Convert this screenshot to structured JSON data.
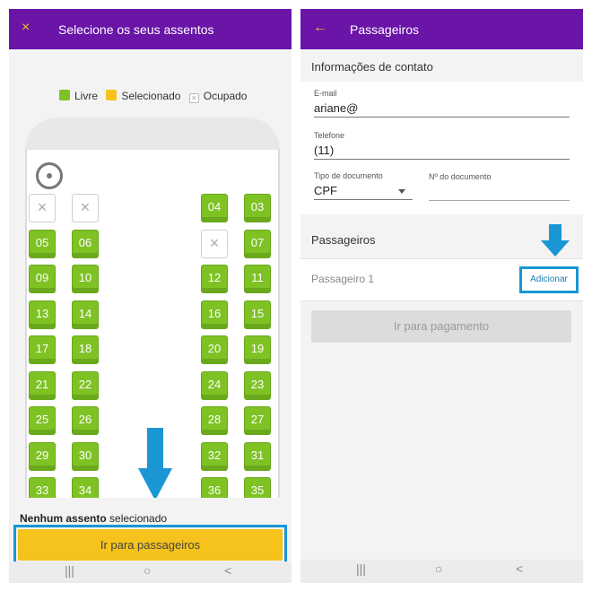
{
  "left": {
    "title": "Selecione os seus assentos",
    "close_icon": "×",
    "legend": {
      "free": "Livre",
      "selected": "Selecionado",
      "occupied": "Ocupado"
    },
    "colors": {
      "free": "#7ec224",
      "selected": "#f6c21c",
      "accent": "#6a14a8",
      "highlight": "#1a96d4"
    },
    "seats": {
      "col1": [
        "",
        "05",
        "09",
        "13",
        "17",
        "21",
        "25",
        "29",
        "33"
      ],
      "col2": [
        "",
        "06",
        "10",
        "14",
        "18",
        "22",
        "26",
        "30",
        "34"
      ],
      "col3": [
        "04",
        "",
        "12",
        "16",
        "20",
        "24",
        "28",
        "32",
        "36"
      ],
      "col4": [
        "03",
        "07",
        "11",
        "15",
        "19",
        "23",
        "27",
        "31",
        "35"
      ]
    },
    "selection_bold": "Nenhum assento",
    "selection_rest": "selecionado",
    "cta_label": "Ir para passageiros"
  },
  "right": {
    "title": "Passageiros",
    "back_icon": "←",
    "contact_section": "Informações de contato",
    "email_label": "E-mail",
    "email_value": "ariane@",
    "phone_label": "Telefone",
    "phone_value": "(11)",
    "doc_type_label": "Tipo de documento",
    "doc_type_value": "CPF",
    "doc_number_label": "Nº do documento",
    "passengers_section": "Passageiros",
    "passenger_1": "Passageiro 1",
    "add_label": "Adicionar",
    "pay_label": "Ir para pagamento"
  },
  "nav": {
    "recents": "|||",
    "home": "○",
    "back": "<"
  }
}
